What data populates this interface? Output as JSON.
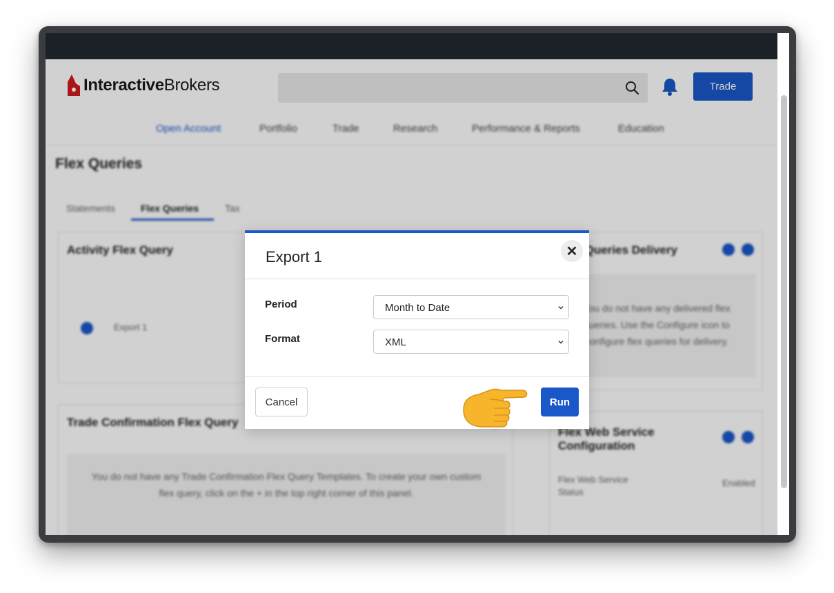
{
  "header": {
    "logo_text_bold": "Interactive",
    "logo_text_regular": "Brokers",
    "trade_label": "Trade"
  },
  "nav": {
    "items": [
      "Open Account",
      "Portfolio",
      "Trade",
      "Research",
      "Performance & Reports",
      "Education"
    ],
    "active_index": 0
  },
  "page": {
    "title": "Flex Queries",
    "tabs": [
      "Statements",
      "Flex Queries",
      "Tax"
    ],
    "active_tab_index": 1
  },
  "cards": {
    "activity_title": "Activity Flex Query",
    "activity_item": "Export 1",
    "trade_conf_title": "Trade Confirmation Flex Query",
    "trade_conf_empty": "You do not have any Trade Confirmation Flex Query Templates. To create your own custom flex query, click on the + in the top right corner of this panel.",
    "delivery_title": "Flex Queries Delivery",
    "delivery_empty": "You do not have any delivered flex queries. Use the Configure icon to configure flex queries for delivery.",
    "web_service_title": "Flex Web Service Configuration",
    "web_service_status_label": "Flex Web Service Status",
    "web_service_status_value": "Enabled"
  },
  "modal": {
    "title": "Export 1",
    "period_label": "Period",
    "period_value": "Month to Date",
    "format_label": "Format",
    "format_value": "XML",
    "cancel_label": "Cancel",
    "run_label": "Run"
  },
  "colors": {
    "accent": "#1a57c8",
    "topbar": "#1c2027",
    "logo_red": "#d01c1c",
    "pointer_yellow": "#f6b52a"
  }
}
